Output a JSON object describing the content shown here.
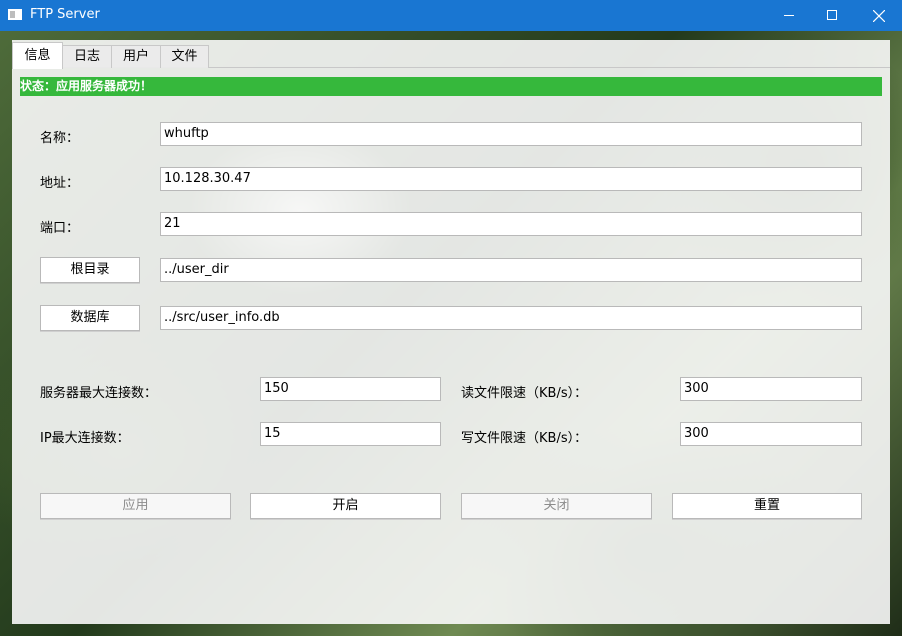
{
  "window": {
    "title": "FTP Server"
  },
  "tabs": [
    "信息",
    "日志",
    "用户",
    "文件"
  ],
  "status": "状态：应用服务器成功！",
  "form": {
    "name_label": "名称：",
    "name_value": "whuftp",
    "address_label": "地址：",
    "address_value": "10.128.30.47",
    "port_label": "端口：",
    "port_value": "21",
    "root_button": "根目录",
    "root_value": "../user_dir",
    "db_button": "数据库",
    "db_value": "../src/user_info.db",
    "max_conn_label": "服务器最大连接数：",
    "max_conn_value": "150",
    "ip_max_label": "IP最大连接数：",
    "ip_max_value": "15",
    "read_limit_label": "读文件限速（KB/s）：",
    "read_limit_value": "300",
    "write_limit_label": "写文件限速（KB/s）：",
    "write_limit_value": "300"
  },
  "actions": {
    "apply": "应用",
    "start": "开启",
    "close": "关闭",
    "reset": "重置"
  },
  "colors": {
    "titlebar": "#1976d2",
    "status_ok": "#36b83c"
  }
}
